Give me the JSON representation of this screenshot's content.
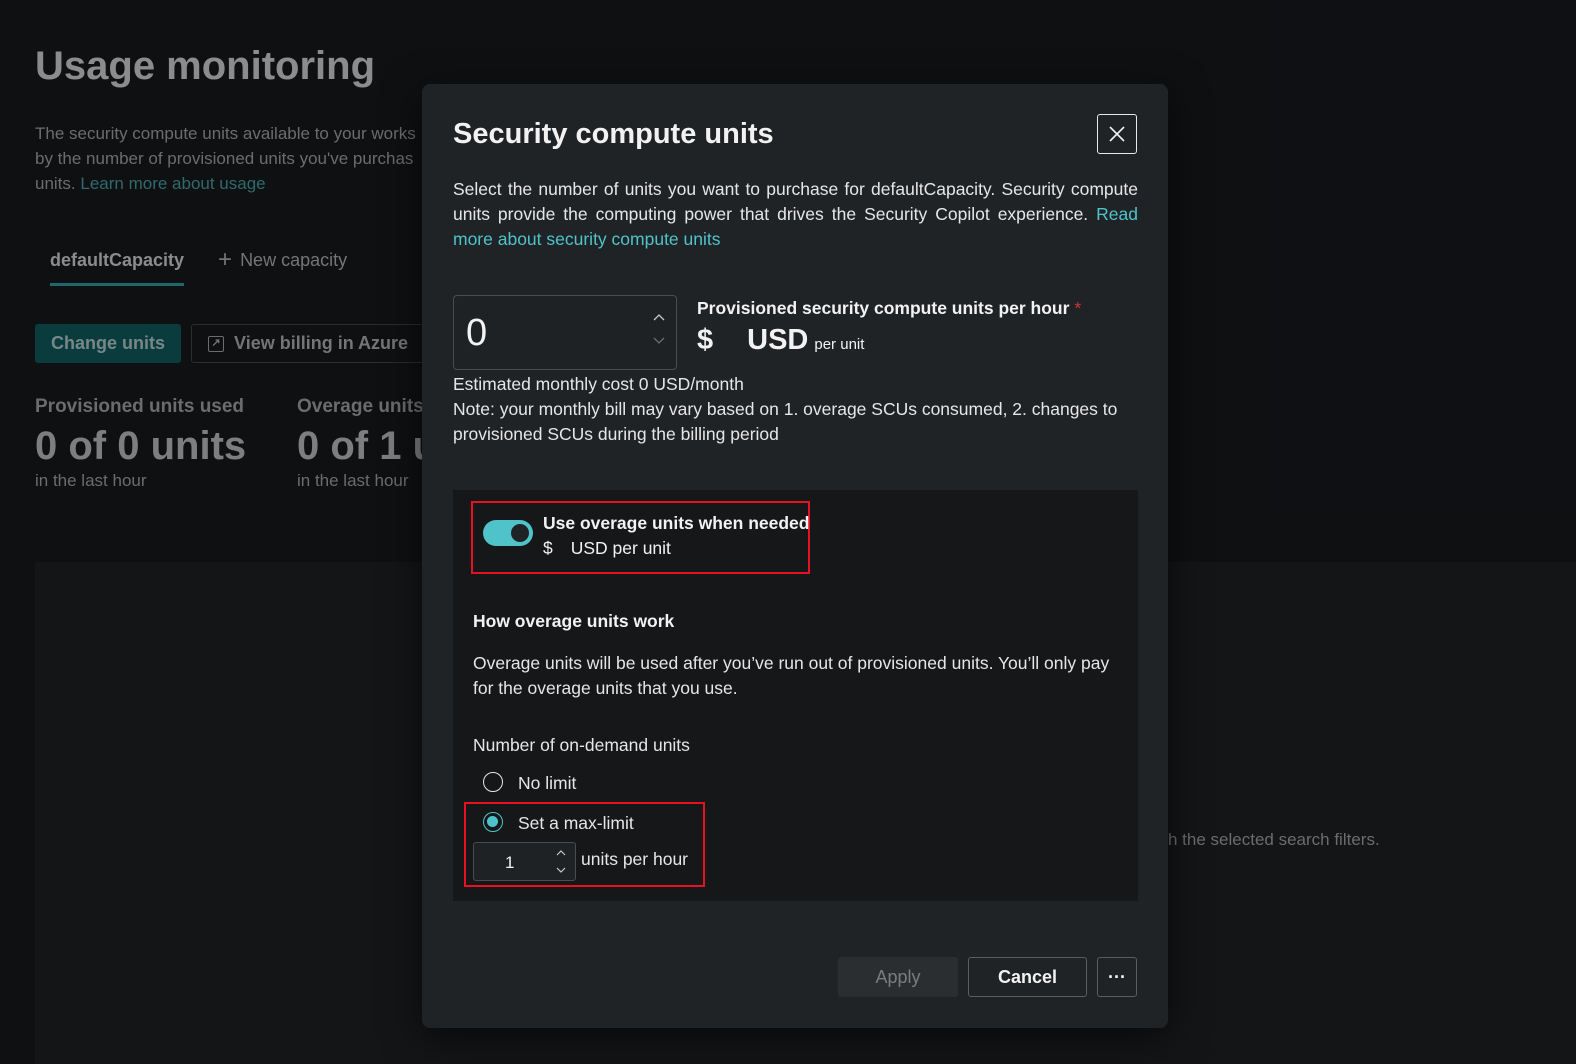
{
  "background": {
    "page_title": "Usage monitoring",
    "description": "The security compute units available to your works\nby the number of provisioned units you've purchas\nunits.",
    "learn_more_link": "Learn more about usage",
    "tabs": [
      {
        "label": "defaultCapacity"
      },
      {
        "label": "New capacity"
      }
    ],
    "buttons": {
      "change_units": "Change units",
      "view_billing": "View billing in Azure"
    },
    "stats": [
      {
        "label": "Provisioned units used",
        "value": "0 of 0 units",
        "sub": "in the last hour"
      },
      {
        "label": "Overage units",
        "value": "0 of 1 u",
        "sub": "in the last hour"
      }
    ],
    "empty_message": "h the selected search filters."
  },
  "dialog": {
    "title": "Security compute units",
    "description": "Select the number of units you want to purchase for defaultCapacity. Security compute units provide the computing power that drives the Security Copilot experience.",
    "description_link": "Read more about security compute units",
    "units_input_value": "0",
    "provisioned_label": "Provisioned security compute units per hour",
    "required_mark": "*",
    "currency_symbol": "$",
    "currency_code": "USD",
    "per_unit": "per unit",
    "estimated_cost": "Estimated monthly cost 0 USD/month",
    "note": "Note: your monthly bill may vary based on 1. overage SCUs consumed, 2. changes to provisioned SCUs during the billing period",
    "overage": {
      "toggle_on": true,
      "title": "Use overage units when needed",
      "price_symbol": "$",
      "price_text": "USD per unit",
      "how_title": "How overage units work",
      "how_desc": "Overage units will be used after you’ve run out of provisioned units. You’ll only pay for the overage units that you use.",
      "on_demand_label": "Number of on-demand units",
      "options": [
        {
          "label": "No limit",
          "selected": false
        },
        {
          "label": "Set a max-limit",
          "selected": true
        }
      ],
      "max_limit_value": "1",
      "units_per_hour": "units per hour"
    },
    "footer": {
      "apply": "Apply",
      "cancel": "Cancel",
      "more": "···"
    }
  },
  "colors": {
    "accent": "#4fc3c9",
    "highlight": "#e81123"
  }
}
